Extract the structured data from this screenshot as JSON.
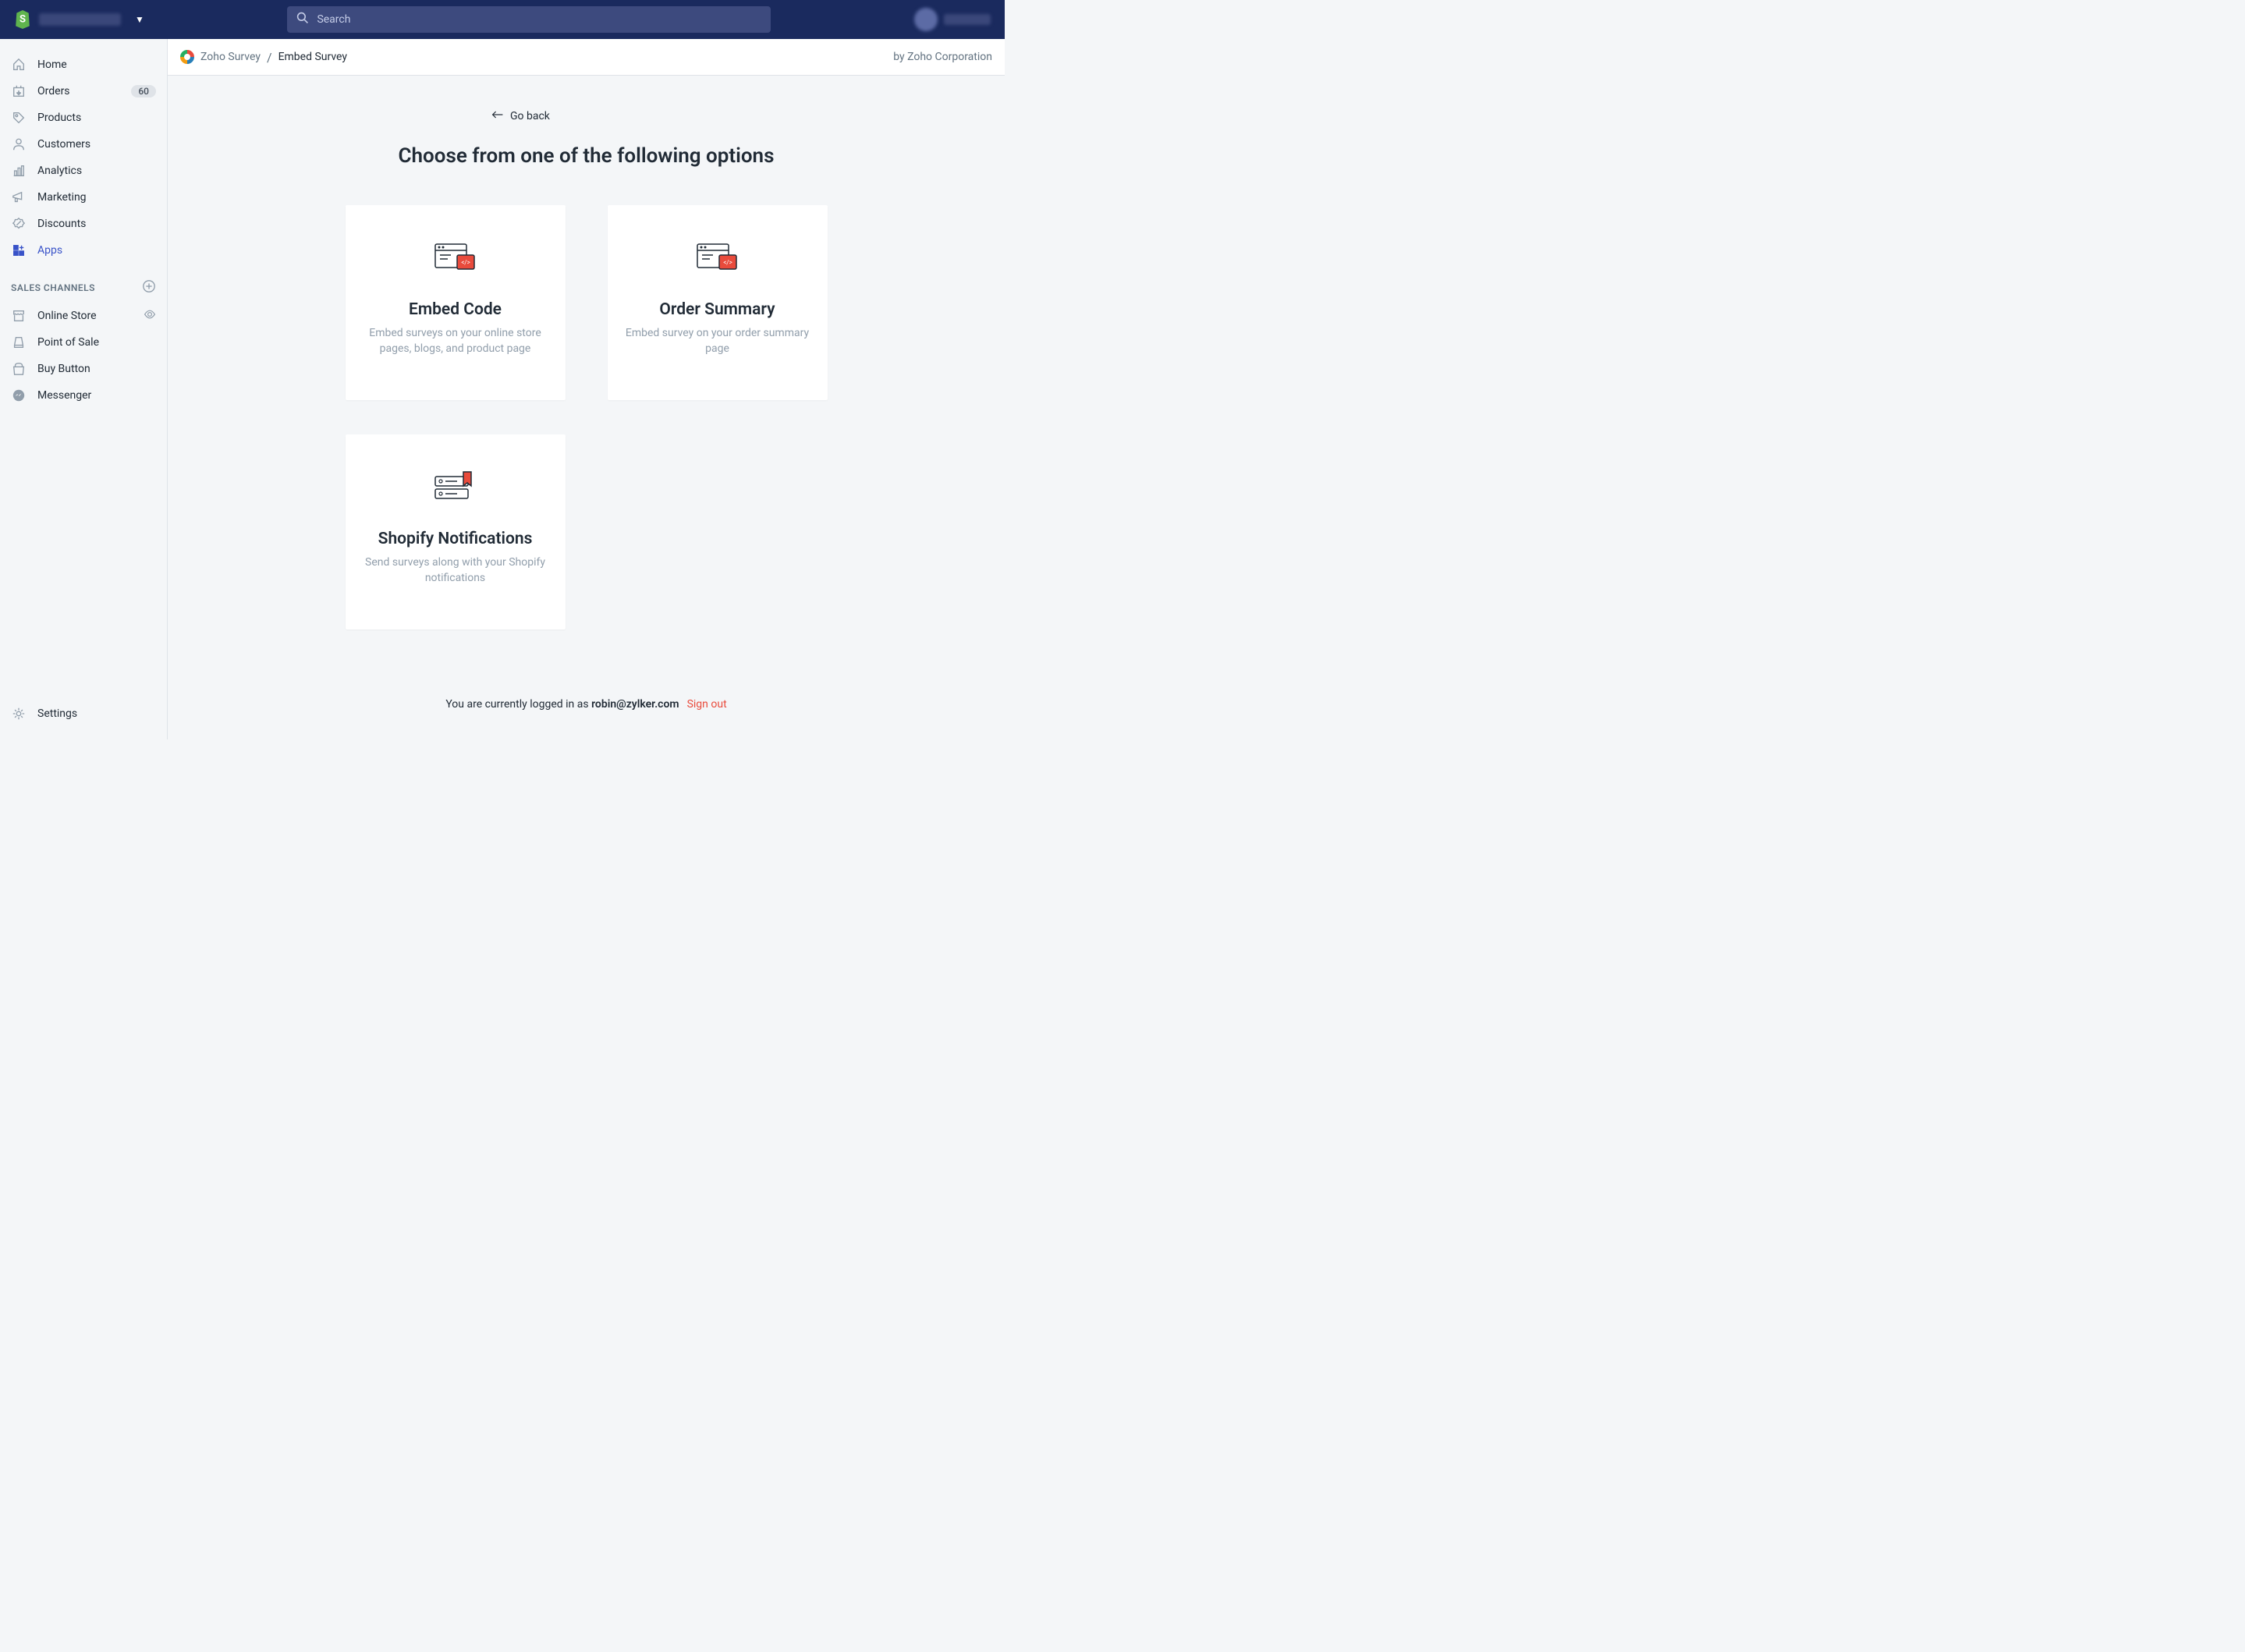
{
  "topbar": {
    "search_placeholder": "Search"
  },
  "sidebar": {
    "items": [
      {
        "label": "Home"
      },
      {
        "label": "Orders",
        "badge": "60"
      },
      {
        "label": "Products"
      },
      {
        "label": "Customers"
      },
      {
        "label": "Analytics"
      },
      {
        "label": "Marketing"
      },
      {
        "label": "Discounts"
      },
      {
        "label": "Apps"
      }
    ],
    "section_label": "SALES CHANNELS",
    "channels": [
      {
        "label": "Online Store"
      },
      {
        "label": "Point of Sale"
      },
      {
        "label": "Buy Button"
      },
      {
        "label": "Messenger"
      }
    ],
    "settings_label": "Settings"
  },
  "breadcrumb": {
    "app": "Zoho Survey",
    "current": "Embed Survey",
    "by": "by Zoho Corporation"
  },
  "content": {
    "go_back": "Go back",
    "heading": "Choose from one of the following options",
    "cards": [
      {
        "title": "Embed Code",
        "desc": "Embed surveys on your online store pages, blogs, and product page"
      },
      {
        "title": "Order Summary",
        "desc": "Embed survey on your order summary page"
      },
      {
        "title": "Shopify Notifications",
        "desc": "Send surveys along with your Shopify notifications"
      }
    ],
    "footer": {
      "prefix": "You are currently logged in as ",
      "email": "robin@zylker.com",
      "signout": "Sign out"
    }
  }
}
